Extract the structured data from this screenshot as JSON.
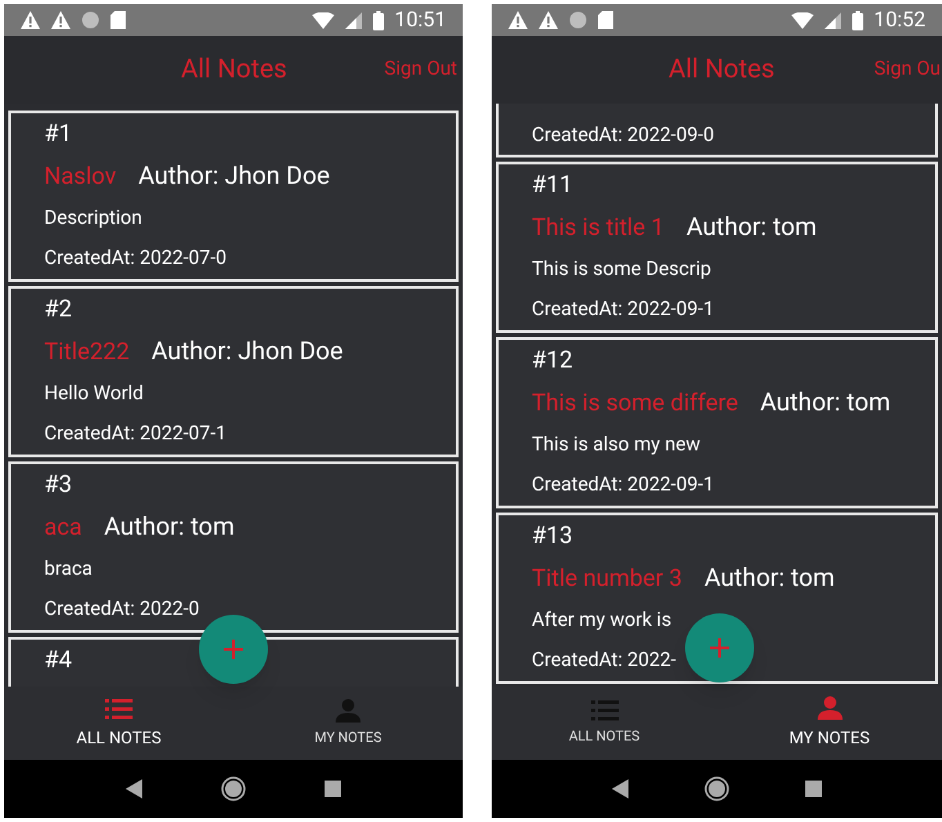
{
  "screens": [
    {
      "status_bar": {
        "time": "10:51"
      },
      "header": {
        "title": "All Notes",
        "sign_out": "Sign Out"
      },
      "notes": [
        {
          "number": "#1",
          "title": "Naslov",
          "author": "Author: Jhon Doe",
          "description": "Description",
          "created_at": "CreatedAt: 2022-07-0"
        },
        {
          "number": "#2",
          "title": "Title222",
          "author": "Author: Jhon Doe",
          "description": "Hello World",
          "created_at": "CreatedAt: 2022-07-1"
        },
        {
          "number": "#3",
          "title": "aca",
          "author": "Author: tom",
          "description": "braca",
          "created_at": "CreatedAt: 2022-0"
        },
        {
          "number": "#4"
        }
      ],
      "tabs": [
        {
          "label": "ALL NOTES",
          "selected": true
        },
        {
          "label": "MY NOTES",
          "selected": false
        }
      ]
    },
    {
      "status_bar": {
        "time": "10:52"
      },
      "header": {
        "title": "All Notes",
        "sign_out": "Sign Ou"
      },
      "notes": [
        {
          "created_at": "CreatedAt: 2022-09-0"
        },
        {
          "number": "#11",
          "title": "This is title 1",
          "author": "Author: tom",
          "description": "This is some Descrip",
          "created_at": "CreatedAt: 2022-09-1"
        },
        {
          "number": "#12",
          "title": "This is some differe",
          "author": "Author: tom",
          "description": "This is also my new",
          "created_at": "CreatedAt: 2022-09-1"
        },
        {
          "number": "#13",
          "title": "Title number 3",
          "author": "Author: tom",
          "description": "After my work is",
          "created_at": "CreatedAt: 2022-"
        }
      ],
      "tabs": [
        {
          "label": "ALL NOTES",
          "selected": false
        },
        {
          "label": "MY NOTES",
          "selected": true
        }
      ]
    }
  ]
}
